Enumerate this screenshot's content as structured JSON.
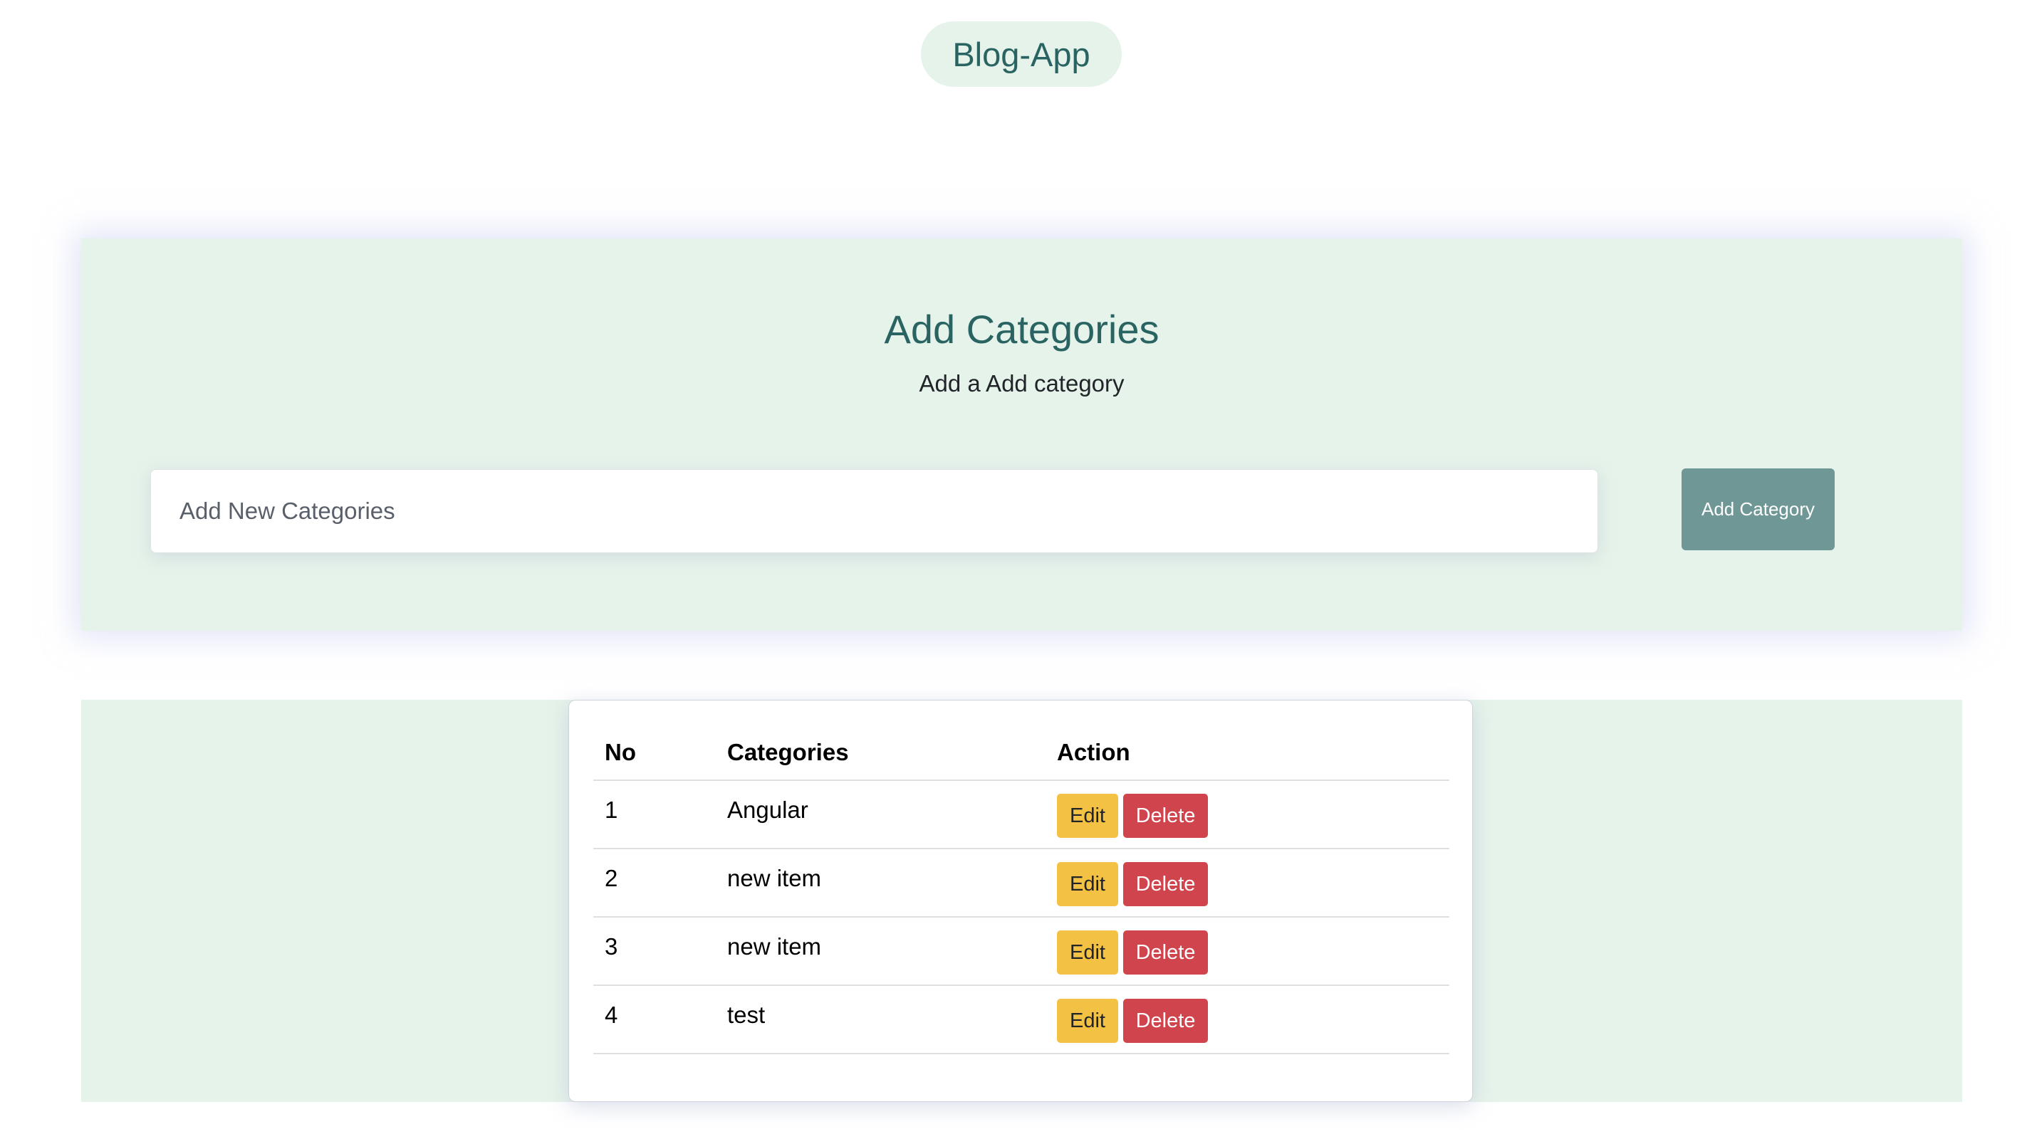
{
  "brand": {
    "label": "Blog-App"
  },
  "add_section": {
    "title": "Add Categories",
    "subtitle": "Add a Add category",
    "input": {
      "placeholder": "Add New Categories",
      "value": ""
    },
    "button_label": "Add Category"
  },
  "table": {
    "headers": {
      "no": "No",
      "category": "Categories",
      "action": "Action"
    },
    "edit_label": "Edit",
    "delete_label": "Delete",
    "rows": [
      {
        "no": "1",
        "category": "Angular"
      },
      {
        "no": "2",
        "category": "new item"
      },
      {
        "no": "3",
        "category": "new item"
      },
      {
        "no": "4",
        "category": "test"
      }
    ]
  },
  "colors": {
    "panel_bg": "#e6f3ea",
    "accent_text": "#2a6462",
    "add_button": "#6e9795",
    "edit_button": "#f3c143",
    "delete_button": "#cf444d"
  }
}
